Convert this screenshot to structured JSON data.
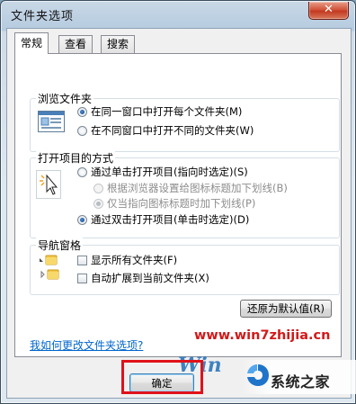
{
  "window": {
    "title": "文件夹选项",
    "close_symbol": "✕"
  },
  "tabs": [
    {
      "label": "常规",
      "active": true
    },
    {
      "label": "查看",
      "active": false
    },
    {
      "label": "搜索",
      "active": false
    }
  ],
  "browse_folders": {
    "title": "浏览文件夹",
    "icon": "browse-folders-icon",
    "options": [
      {
        "label": "在同一窗口中打开每个文件夹(M)",
        "checked": true
      },
      {
        "label": "在不同窗口中打开不同的文件夹(W)",
        "checked": false
      }
    ]
  },
  "open_items": {
    "title": "打开项目的方式",
    "icon": "click-cursor-icon",
    "options": [
      {
        "label": "通过单击打开项目(指向时选定)(S)",
        "checked": false,
        "disabled": false
      },
      {
        "label": "根据浏览器设置给图标标题加下划线(B)",
        "checked": false,
        "disabled": true
      },
      {
        "label": "仅当指向图标标题时加下划线(P)",
        "checked": true,
        "disabled": true
      },
      {
        "label": "通过双击打开项目(单击时选定)(D)",
        "checked": true,
        "disabled": false
      }
    ]
  },
  "nav_pane": {
    "title": "导航窗格",
    "options": [
      {
        "label": "显示所有文件夹(F)",
        "checked": false
      },
      {
        "label": "自动扩展到当前文件夹(X)",
        "checked": false
      }
    ]
  },
  "restore_defaults_label": "还原为默认值(R)",
  "help_link": "我如何更改文件夹选项?",
  "ok_label": "确定",
  "watermark": {
    "url": "www.win7zhijia.cn",
    "logo_text": "Win",
    "site_name": "系统之家"
  },
  "colors": {
    "link": "#0066cc",
    "highlight": "#e0121a",
    "watermark_red": "#d11a1a"
  }
}
